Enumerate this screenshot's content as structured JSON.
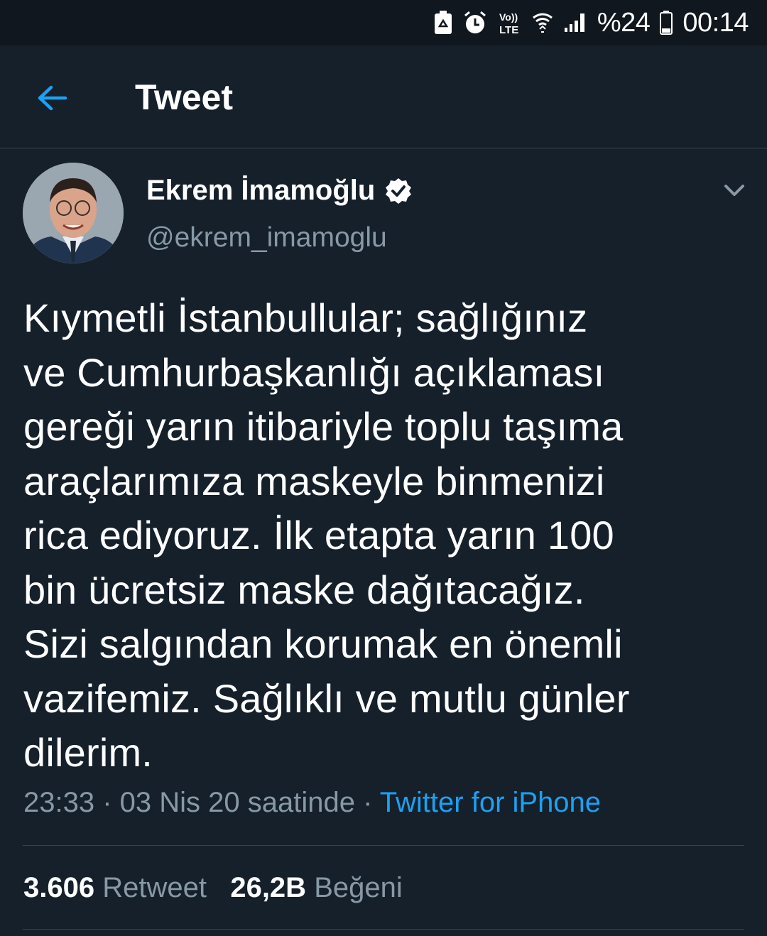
{
  "status_bar": {
    "icons": [
      "recycle-notification-icon",
      "alarm-icon",
      "volte-icon",
      "wifi-icon",
      "signal-icon",
      "battery-icon"
    ],
    "volte_text": "Vo)) LTE",
    "battery": "%24",
    "time": "00:14"
  },
  "header": {
    "back_icon": "arrow-left-icon",
    "title": "Tweet"
  },
  "author": {
    "name": "Ekrem İmamoğlu",
    "verified_icon": "verified-badge-icon",
    "handle": "@ekrem_imamoglu"
  },
  "tweet": {
    "lines": [
      "Kıymetli İstanbullular; sağlığınız",
      "ve Cumhurbaşkanlığı açıklaması",
      "gereği yarın itibariyle toplu taşıma",
      "araçlarımıza maskeyle binmenizi",
      "rica ediyoruz. İlk etapta yarın 100",
      "bin ücretsiz maske dağıtacağız.",
      "Sizi salgından korumak en önemli",
      "vazifemiz. Sağlıklı ve mutlu günler",
      "dilerim."
    ],
    "timestamp": "23:33 · 03 Nis 20 saatinde · ",
    "source": "Twitter for iPhone"
  },
  "stats": {
    "retweet_count": "3.606",
    "retweet_label": "Retweet",
    "like_count": "26,2B",
    "like_label": "Beğeni"
  },
  "colors": {
    "background": "#15202b",
    "status_bar": "#10171e",
    "accent": "#1da1f2",
    "secondary_text": "#8899a6",
    "divider": "#38444d"
  }
}
